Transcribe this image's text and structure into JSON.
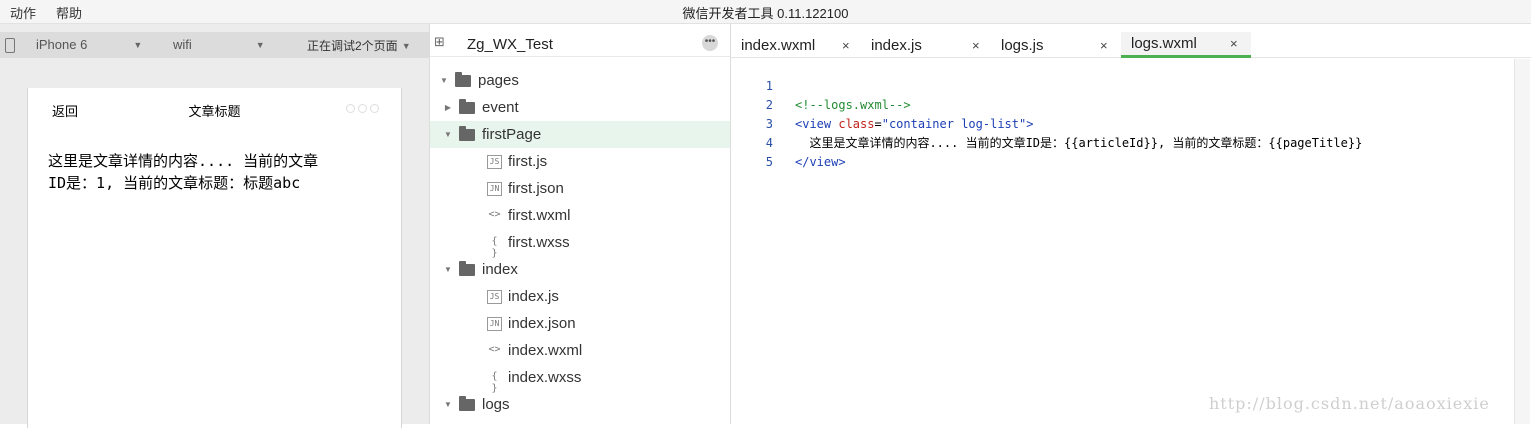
{
  "menu": {
    "items": [
      "动作",
      "帮助"
    ]
  },
  "app_title": "微信开发者工具 0.11.122100",
  "simulator": {
    "device": "iPhone 6",
    "network": "wifi",
    "debug_status": "正在调试2个页面",
    "nav": {
      "back": "返回",
      "title": "文章标题"
    },
    "content_line1": "这里是文章详情的内容.... 当前的文章",
    "content_line2": "ID是：1, 当前的文章标题：标题abc"
  },
  "file_tree": {
    "project": "Zg_WX_Test",
    "items": [
      {
        "label": "pages",
        "type": "folder",
        "expanded": true
      },
      {
        "label": "event",
        "type": "folder",
        "expanded": false
      },
      {
        "label": "firstPage",
        "type": "folder",
        "expanded": true,
        "selected": true
      },
      {
        "label": "first.js",
        "type": "js"
      },
      {
        "label": "first.json",
        "type": "json"
      },
      {
        "label": "first.wxml",
        "type": "wxml"
      },
      {
        "label": "first.wxss",
        "type": "wxss"
      },
      {
        "label": "index",
        "type": "folder",
        "expanded": true
      },
      {
        "label": "index.js",
        "type": "js"
      },
      {
        "label": "index.json",
        "type": "json"
      },
      {
        "label": "index.wxml",
        "type": "wxml"
      },
      {
        "label": "index.wxss",
        "type": "wxss"
      },
      {
        "label": "logs",
        "type": "folder",
        "expanded": true
      }
    ],
    "icons": {
      "js": "JS",
      "json": "JN",
      "wxml": "<>",
      "wxss": "{ }"
    }
  },
  "editor": {
    "tabs": [
      {
        "label": "index.wxml",
        "active": false
      },
      {
        "label": "index.js",
        "active": false
      },
      {
        "label": "logs.js",
        "active": false
      },
      {
        "label": "logs.wxml",
        "active": true
      }
    ],
    "close_glyph": "×",
    "lines": [
      {
        "n": "1",
        "comment": "<!--logs.wxml-->"
      },
      {
        "n": "2",
        "open": "<view ",
        "attr": "class",
        "eq": "=",
        "value": "\"container log-list\"",
        "close": ">"
      },
      {
        "n": "3",
        "text": "  这里是文章详情的内容.... 当前的文章ID是：{{articleId}}, 当前的文章标题：{{pageTitle}}"
      },
      {
        "n": "4",
        "endtag": "</view>"
      },
      {
        "n": "5"
      }
    ]
  },
  "accent_color": "#4caf50",
  "watermark": "http://blog.csdn.net/aoaoxiexie"
}
